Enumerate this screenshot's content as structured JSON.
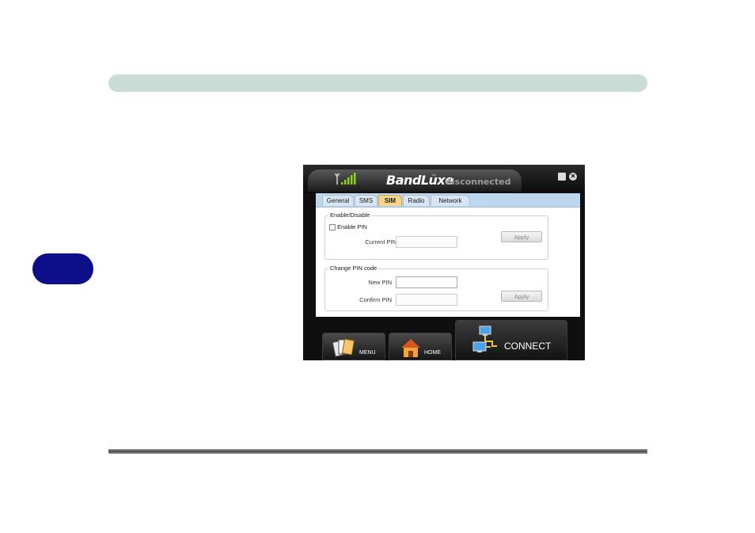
{
  "app": {
    "brand": "BandLuxe",
    "trademark": "™",
    "status": "disconnected"
  },
  "tabs": [
    {
      "label": "General"
    },
    {
      "label": "SMS"
    },
    {
      "label": "SIM",
      "active": true
    },
    {
      "label": "Radio"
    },
    {
      "label": "Network"
    }
  ],
  "enable_group": {
    "title": "Enable/Disable",
    "checkbox_label": "Enable PIN",
    "checked": false,
    "current_pin_label": "Current PIN",
    "current_pin_value": "",
    "apply_label": "Apply"
  },
  "change_group": {
    "title": "Change PIN code",
    "new_pin_label": "New PIN",
    "new_pin_value": "",
    "confirm_pin_label": "Confirm PIN",
    "confirm_pin_value": "",
    "apply_label": "Apply"
  },
  "toolbar": {
    "menu_label": "MENU",
    "home_label": "HOME",
    "connect_label": "CONNECT"
  },
  "colors": {
    "top_bar": "#c9dcd5",
    "side_tab": "#0c0e8a",
    "active_tab": "#f6d58a",
    "tab_strip": "#bdd7ee"
  }
}
